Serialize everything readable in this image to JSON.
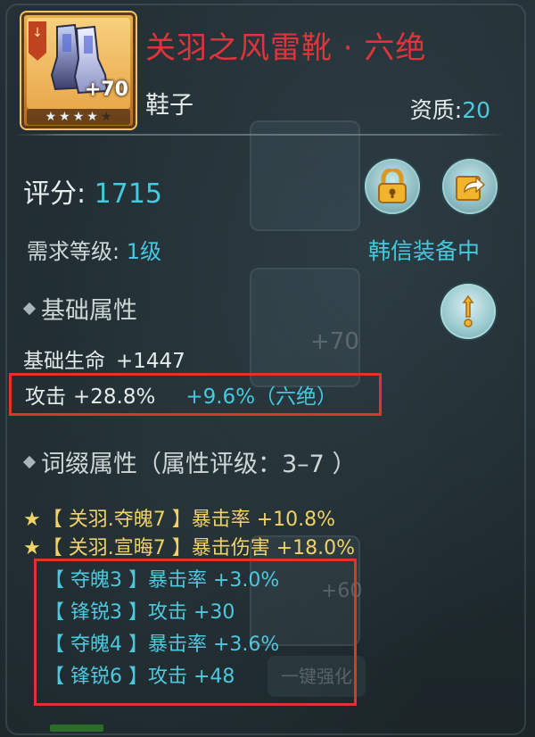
{
  "item": {
    "name": "关羽之风雷靴 · 六绝",
    "type": "鞋子",
    "aptitude_label": "资质:",
    "aptitude_value": "20",
    "plus_level": "+70",
    "stars_filled": 4,
    "stars_total": 5,
    "icon": "boots-icon"
  },
  "stats": {
    "score_label": "评分:",
    "score_value": "1715",
    "req_level_label": "需求等级:",
    "req_level_value": "1级",
    "equipped_status": "韩信装备中"
  },
  "buttons": {
    "lock_icon": "lock-icon",
    "share_icon": "share-icon",
    "info_icon": "info-icon"
  },
  "base_section": {
    "title": "基础属性",
    "hp_label": "基础生命",
    "hp_value": "+1447",
    "atk_label": "攻击",
    "atk_value": "+28.8%",
    "atk_extra": "+9.6%（六绝）"
  },
  "affix_section": {
    "title": "词缀属性（属性评级：3–7 ）",
    "gold_affixes": [
      {
        "star": "★",
        "tag": "【 关羽.夺魄7 】",
        "attr": "暴击率 +10.8%"
      },
      {
        "star": "★",
        "tag": "【 关羽.宣晦7 】",
        "attr": "暴击伤害 +18.0%"
      }
    ],
    "blue_affixes": [
      {
        "tag": "【 夺魄3 】",
        "attr": "暴击率 +3.0%"
      },
      {
        "tag": "【 锋锐3 】",
        "attr": "攻击 +30"
      },
      {
        "tag": "【 夺魄4 】",
        "attr": "暴击率 +3.6%"
      },
      {
        "tag": "【 锋锐6 】",
        "attr": "攻击 +48"
      }
    ]
  },
  "background": {
    "ghost_plus_1": "+70",
    "ghost_plus_2": "+60",
    "ghost_button": "一键强化"
  },
  "colors": {
    "title_red": "#e0343a",
    "cyan": "#45c9e0",
    "gold": "#f1d26a",
    "highlight_box": "#e0332f"
  }
}
